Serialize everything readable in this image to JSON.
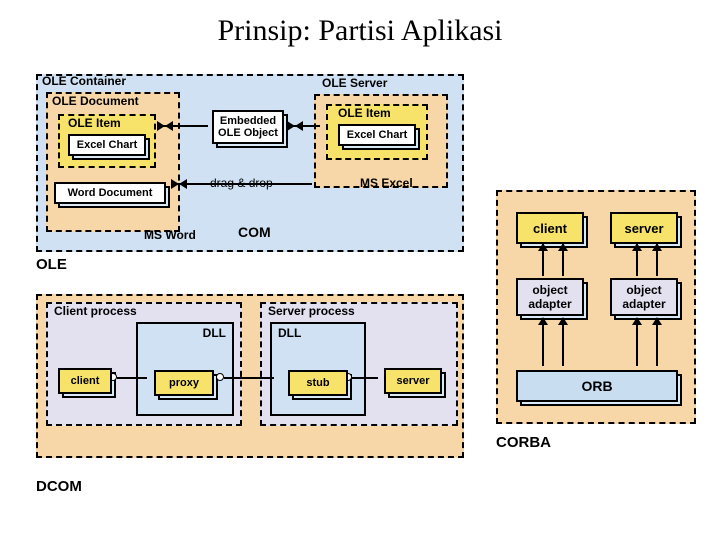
{
  "title": "Prinsip: Partisi Aplikasi",
  "ole": {
    "container": "OLE Container",
    "document": "OLE Document",
    "item": "OLE Item",
    "chart": "Excel Chart",
    "word_doc": "Word Document",
    "ms_word": "MS Word",
    "embedded1": "Embedded",
    "embedded2": "OLE Object",
    "drag_drop": "drag & drop",
    "server": "OLE Server",
    "ms_excel": "MS Excel",
    "com": "COM",
    "label": "OLE"
  },
  "dcom": {
    "client_process": "Client process",
    "server_process": "Server process",
    "dll": "DLL",
    "client": "client",
    "proxy": "proxy",
    "stub": "stub",
    "server": "server",
    "label": "DCOM"
  },
  "corba": {
    "client": "client",
    "server": "server",
    "obj_adapter1": "object",
    "obj_adapter2": "adapter",
    "orb": "ORB",
    "label": "CORBA"
  }
}
